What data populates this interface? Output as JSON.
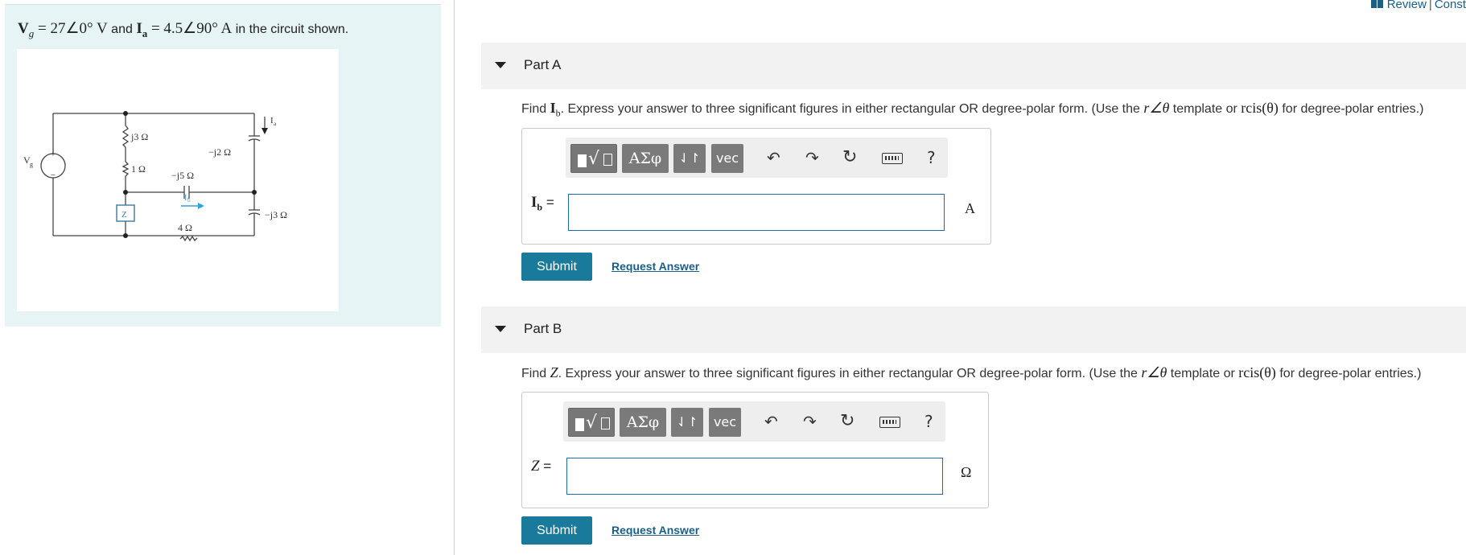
{
  "top_links": {
    "review": "Review",
    "separator": "|",
    "constants": "Const"
  },
  "problem": {
    "vg": "V",
    "vg_sub": "g",
    "vg_value": " = 27∠0° V",
    "and": " and ",
    "ia": "I",
    "ia_sub": "a",
    "ia_value": " = 4.5∠90° A",
    "suffix": " in the circuit shown."
  },
  "figure": {
    "source_label": "V",
    "source_sub": "g",
    "plus": "+",
    "minus": "−",
    "ia_label": "I",
    "ia_sub": "a",
    "ib_label": "I",
    "ib_sub": "b",
    "j3": "j3 Ω",
    "r1": "1 Ω",
    "mj2": "−j2 Ω",
    "mj5": "−j5 Ω",
    "mj3": "−j3 Ω",
    "r4": "4 Ω",
    "z": "Z"
  },
  "parts": [
    {
      "title": "Part A",
      "find": "Find ",
      "find_var": "I",
      "find_var_sub": "b",
      "instruction_mid": ". Express your answer to three significant figures in either rectangular OR degree-polar form. (Use the ",
      "template_a": "r∠θ",
      "instruction_or": " template or ",
      "template_b": "rcis(θ)",
      "instruction_end": " for degree-polar entries.)",
      "var_label": "I",
      "var_sub": "b",
      "equals": " =",
      "unit": "A",
      "input_value": "",
      "submit": "Submit",
      "request": "Request Answer"
    },
    {
      "title": "Part B",
      "find": "Find ",
      "find_var": "Z",
      "find_var_sub": "",
      "instruction_mid": ". Express your answer to three significant figures in either rectangular OR degree-polar form. (Use the ",
      "template_a": "r∠θ",
      "instruction_or": " template or ",
      "template_b": "rcis(θ)",
      "instruction_end": " for degree-polar entries.)",
      "var_label": "Z",
      "var_sub": "",
      "equals": " =",
      "unit": "Ω",
      "input_value": "",
      "submit": "Submit",
      "request": "Request Answer"
    }
  ],
  "toolbar": {
    "templates_icon": "templates-icon",
    "greek": "ΑΣφ",
    "arrows": "⇃↾",
    "vec": "vec",
    "undo": "↶",
    "redo": "↷",
    "reset": "↻",
    "help": "?"
  }
}
